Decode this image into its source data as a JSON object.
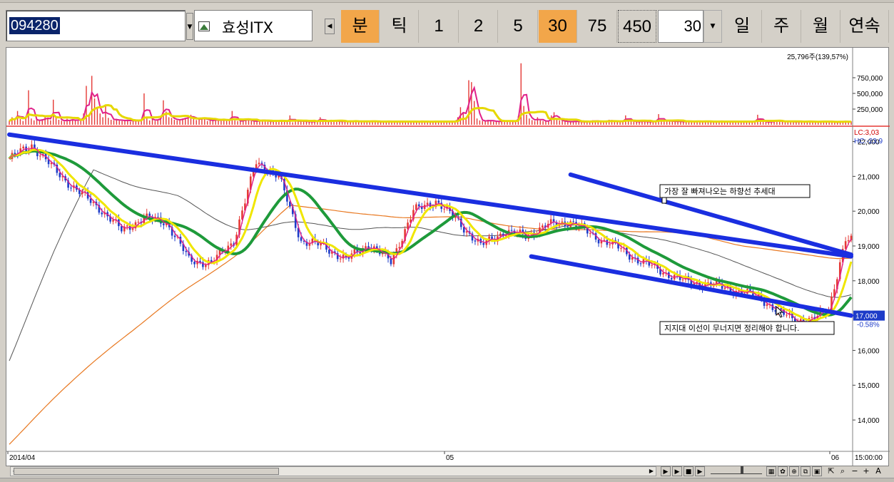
{
  "window": {
    "stock_code": "094280",
    "stock_name": "효성ITX"
  },
  "toolbar": {
    "timeframes": [
      {
        "label": "분",
        "active": true
      },
      {
        "label": "틱",
        "active": false
      },
      {
        "label": "1",
        "active": false
      },
      {
        "label": "2",
        "active": false
      },
      {
        "label": "5",
        "active": false
      },
      {
        "label": "30",
        "active": true
      },
      {
        "label": "75",
        "active": false
      },
      {
        "label": "450",
        "active": false
      }
    ],
    "period_value": "30",
    "periods": [
      "일",
      "주",
      "월",
      "연속"
    ],
    "accent_color": "#f2a64a"
  },
  "chart_data": [
    {
      "type": "bar",
      "panel": "volume",
      "title": "25,796주(139,57%)",
      "ylabel": "",
      "yticks": [
        "750,000",
        "500,000",
        "250,000"
      ],
      "ytick_values": [
        750000,
        500000,
        250000
      ],
      "ylim": [
        0,
        1000000
      ],
      "bar_color": "#e53935",
      "series": [
        {
          "name": "거래량",
          "type": "bar",
          "color": "#e53935",
          "values": [
            60000,
            120000,
            80000,
            220000,
            90000,
            60000,
            140000,
            550000,
            100000,
            70000,
            80000,
            60000,
            90000,
            120000,
            100000,
            70000,
            400000,
            110000,
            80000,
            65000,
            50000,
            95000,
            60000,
            85000,
            75000,
            60000,
            95000,
            180000,
            620000,
            150000,
            780000,
            420000,
            260000,
            180000,
            120000,
            300000,
            110000,
            80000,
            70000,
            95000,
            65000,
            60000,
            80000,
            70000,
            50000,
            80000,
            60000,
            55000,
            90000,
            500000,
            120000,
            70000,
            95000,
            60000,
            80000,
            140000,
            390000,
            210000,
            120000,
            110000,
            80000,
            70000,
            90000,
            100000,
            110000,
            120000,
            160000,
            100000,
            75000,
            90000,
            110000,
            100000,
            60000,
            80000,
            65000,
            85000,
            70000,
            60000,
            95000,
            60000,
            80000,
            220000,
            70000,
            60000,
            50000,
            80000,
            90000,
            70000,
            60000,
            50000,
            65000,
            70000,
            80000,
            60000,
            50000,
            55000,
            60000,
            70000,
            65000,
            60000,
            50000,
            55000,
            150000,
            40000,
            60000,
            70000,
            50000,
            55000,
            60000,
            40000,
            50000,
            60000,
            70000,
            120000,
            50000,
            60000,
            40000,
            80000,
            60000,
            50000,
            55000,
            60000,
            45000,
            50000,
            60000,
            55000,
            70000,
            50000,
            45000,
            60000,
            50000,
            55000,
            60000,
            50000,
            45000,
            40000,
            60000,
            50000,
            55000,
            50000,
            45000,
            60000,
            55000,
            50000,
            45000,
            40000,
            60000,
            55000,
            50000,
            45000,
            60000,
            55000,
            50000,
            45000,
            40000,
            50000,
            60000,
            55000,
            50000,
            45000,
            60000,
            55000,
            50000,
            120000,
            280000,
            180000,
            90000,
            710000,
            680000,
            380000,
            100000,
            70000,
            60000,
            55000,
            80000,
            65000,
            50000,
            55000,
            60000,
            50000,
            70000,
            60000,
            50000,
            55000,
            60000,
            140000,
            980000,
            300000,
            160000,
            100000,
            75000,
            60000,
            120000,
            70000,
            60000,
            55000,
            60000,
            150000,
            200000,
            80000,
            70000,
            60000,
            55000,
            50000,
            45000,
            60000,
            55000,
            50000,
            45000,
            40000,
            60000,
            50000,
            70000,
            60000,
            55000,
            50000,
            45000,
            60000,
            80000,
            55000,
            50000,
            45000,
            60000,
            55000,
            150000,
            70000,
            60000,
            50000,
            45000,
            55000,
            60000,
            50000,
            45000,
            50000,
            55000,
            60000,
            170000,
            55000,
            60000,
            70000,
            55000,
            50000,
            60000,
            55000,
            50000,
            45000,
            60000,
            55000,
            50000,
            45000,
            60000,
            50000,
            55000,
            60000,
            50000,
            45000,
            40000,
            60000,
            50000,
            55000,
            50000,
            45000,
            60000,
            55000,
            50000,
            45000,
            40000,
            60000,
            55000,
            50000,
            45000,
            60000,
            160000,
            55000,
            50000,
            45000,
            40000,
            60000,
            55000,
            70000,
            50000,
            45000,
            60000,
            55000,
            50000,
            45000,
            40000,
            60000,
            50000,
            45000,
            60000,
            55000,
            50000,
            45000,
            40000,
            50000,
            60000,
            55000,
            50000,
            45000,
            40000,
            35000,
            60000,
            55000,
            50000,
            45000,
            55000
          ]
        },
        {
          "name": "거래량 이동평균(단기)",
          "type": "line",
          "color": "#e0218a"
        },
        {
          "name": "거래량 이동평균(장기)",
          "type": "line",
          "color": "#e6d800"
        }
      ]
    },
    {
      "type": "line",
      "panel": "price",
      "title": "",
      "xlabel": "",
      "ylabel": "",
      "x_tick_labels": [
        "2014/04",
        "05",
        "06"
      ],
      "x_tick_time_label": "15:00:00",
      "yticks": [
        "22,000",
        "21,000",
        "20,000",
        "19,000",
        "18,000",
        "17,000",
        "16,000",
        "15,000",
        "14,000"
      ],
      "ytick_values": [
        22000,
        21000,
        20000,
        19000,
        18000,
        17000,
        16000,
        15000,
        14000
      ],
      "ylim": [
        13100,
        22400
      ],
      "grid": false,
      "right_labels": {
        "lc": "LC:3,03",
        "hc": "HC:-23,9",
        "last_price": "17,000",
        "change": "-0.58%"
      },
      "x_index_range": [
        0,
        300
      ],
      "series": [
        {
          "name": "종가",
          "color": "#1e3cc8",
          "x": [
            0,
            8,
            16,
            24,
            32,
            40,
            48,
            56,
            64,
            72,
            80,
            88,
            96,
            104,
            112,
            120,
            128,
            136,
            144,
            152,
            160,
            168,
            176,
            184,
            192,
            200,
            208,
            216,
            224,
            232,
            240,
            248,
            256,
            262,
            268,
            274,
            280,
            286,
            292,
            298
          ],
          "y": [
            21500,
            21900,
            21200,
            20600,
            20100,
            19450,
            19800,
            19700,
            18600,
            18500,
            19150,
            21400,
            21000,
            19150,
            19000,
            18600,
            19050,
            18550,
            20000,
            20300,
            19700,
            19000,
            19400,
            19300,
            19600,
            19700,
            19300,
            19000,
            18600,
            18300,
            18000,
            17900,
            17800,
            17650,
            17500,
            17100,
            16900,
            16850,
            17200,
            19150
          ]
        },
        {
          "name": "이동평균선 5",
          "color": "#e0218a"
        },
        {
          "name": "이동평균선 20",
          "color": "#f0e600"
        },
        {
          "name": "이동평균선 60",
          "color": "#1e9a3a"
        },
        {
          "name": "이동평균선 120",
          "color": "#555555"
        },
        {
          "name": "이동평균선 240",
          "color": "#e87820"
        }
      ],
      "annotations": [
        {
          "text": "가장 잘 빠져나오는 하향선 추세대",
          "kind": "label"
        },
        {
          "text": "지지대 이선이 무너지면 정리해야 합니다.",
          "kind": "label"
        }
      ],
      "trendlines": [
        {
          "name": "상단 장기 추세선",
          "color": "#1a2ee0",
          "points": [
            [
              0,
              22200
            ],
            [
              300,
              18700
            ]
          ]
        },
        {
          "name": "하단 지지선",
          "color": "#1a2ee0",
          "points": [
            [
              186,
              18700
            ],
            [
              300,
              17000
            ]
          ]
        },
        {
          "name": "단기 하향 추세선",
          "color": "#1a2ee0",
          "points": [
            [
              200,
              21050
            ],
            [
              300,
              18750
            ]
          ]
        }
      ]
    }
  ]
}
